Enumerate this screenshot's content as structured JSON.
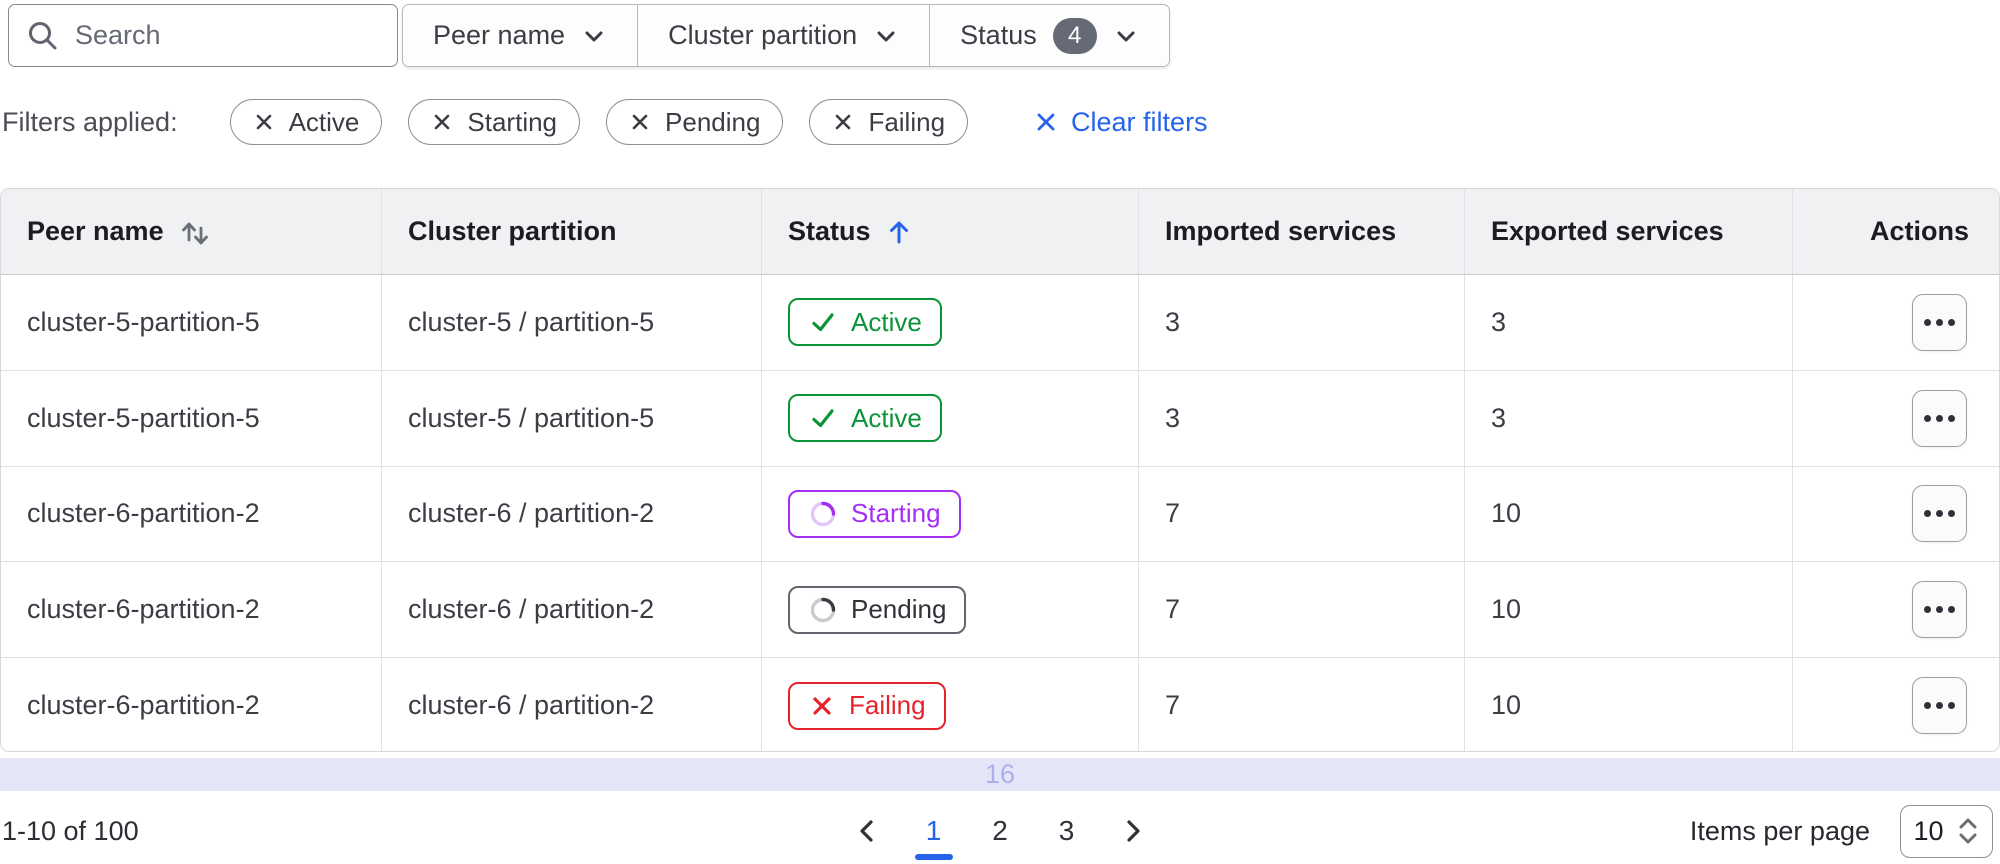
{
  "toolbar": {
    "search": {
      "placeholder": "Search"
    },
    "dropdowns": {
      "peer_name": {
        "label": "Peer name"
      },
      "cluster_partition": {
        "label": "Cluster partition"
      },
      "status": {
        "label": "Status",
        "count": "4"
      }
    }
  },
  "filters": {
    "label": "Filters applied:",
    "chips": [
      {
        "label": "Active"
      },
      {
        "label": "Starting"
      },
      {
        "label": "Pending"
      },
      {
        "label": "Failing"
      }
    ],
    "clear_label": "Clear filters"
  },
  "table": {
    "columns": {
      "peer": {
        "label": "Peer name",
        "sort": "sortable"
      },
      "partition": {
        "label": "Cluster partition"
      },
      "status": {
        "label": "Status",
        "sort": "ascending"
      },
      "imported": {
        "label": "Imported services"
      },
      "exported": {
        "label": "Exported services"
      },
      "actions": {
        "label": "Actions"
      }
    },
    "rows": [
      {
        "peer": "cluster-5-partition-5",
        "partition": "cluster-5 / partition-5",
        "status": "Active",
        "imported": "3",
        "exported": "3"
      },
      {
        "peer": "cluster-5-partition-5",
        "partition": "cluster-5 / partition-5",
        "status": "Active",
        "imported": "3",
        "exported": "3"
      },
      {
        "peer": "cluster-6-partition-2",
        "partition": "cluster-6 / partition-2",
        "status": "Starting",
        "imported": "7",
        "exported": "10"
      },
      {
        "peer": "cluster-6-partition-2",
        "partition": "cluster-6 / partition-2",
        "status": "Pending",
        "imported": "7",
        "exported": "10"
      },
      {
        "peer": "cluster-6-partition-2",
        "partition": "cluster-6 / partition-2",
        "status": "Failing",
        "imported": "7",
        "exported": "10"
      }
    ]
  },
  "band": {
    "text": "16"
  },
  "pagination": {
    "range_text": "1-10 of 100",
    "pages": [
      "1",
      "2",
      "3"
    ],
    "current_page": "1",
    "items_per_page_label": "Items per page",
    "items_per_page_value": "10"
  },
  "colors": {
    "accent_blue": "#2563eb",
    "status_active_green": "#0c9338",
    "status_starting_purple": "#a42ef5",
    "status_pending_gray": "#63666e",
    "status_failing_red": "#e5232a",
    "badge_count_gray": "#656a76",
    "band_background": "#e5e5f8",
    "band_text": "#acb1ec",
    "header_background": "#f0f1f2"
  }
}
